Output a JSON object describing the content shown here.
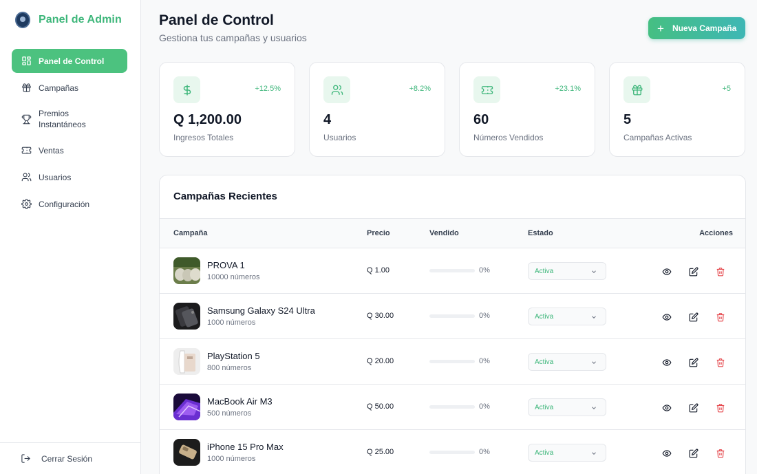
{
  "sidebar": {
    "brand": "Panel de Admin",
    "items": [
      {
        "label": "Panel de Control",
        "icon": "dashboard-icon",
        "active": true
      },
      {
        "label": "Campañas",
        "icon": "gift-icon"
      },
      {
        "label": "Premios Instantáneos",
        "icon": "trophy-icon"
      },
      {
        "label": "Ventas",
        "icon": "ticket-icon"
      },
      {
        "label": "Usuarios",
        "icon": "users-icon"
      },
      {
        "label": "Configuración",
        "icon": "gear-icon"
      }
    ],
    "logout": "Cerrar Sesión"
  },
  "header": {
    "title": "Panel de Control",
    "subtitle": "Gestiona tus campañas y usuarios",
    "new_button": "Nueva Campaña"
  },
  "stats": [
    {
      "value": "Q 1,200.00",
      "label": "Ingresos Totales",
      "change": "+12.5%",
      "icon": "dollar-icon"
    },
    {
      "value": "4",
      "label": "Usuarios",
      "change": "+8.2%",
      "icon": "users-icon"
    },
    {
      "value": "60",
      "label": "Números Vendidos",
      "change": "+23.1%",
      "icon": "ticket-icon"
    },
    {
      "value": "5",
      "label": "Campañas Activas",
      "change": "+5",
      "icon": "gift-icon"
    }
  ],
  "campaigns": {
    "title": "Campañas Recientes",
    "columns": {
      "campaign": "Campaña",
      "price": "Precio",
      "sold": "Vendido",
      "status": "Estado",
      "actions": "Acciones"
    },
    "rows": [
      {
        "name": "PROVA 1",
        "count": "10000 números",
        "price": "Q 1.00",
        "progress": 0,
        "pct": "0%",
        "status": "Activa"
      },
      {
        "name": "Samsung Galaxy S24 Ultra",
        "count": "1000 números",
        "price": "Q 30.00",
        "progress": 0,
        "pct": "0%",
        "status": "Activa"
      },
      {
        "name": "PlayStation 5",
        "count": "800 números",
        "price": "Q 20.00",
        "progress": 0,
        "pct": "0%",
        "status": "Activa"
      },
      {
        "name": "MacBook Air M3",
        "count": "500 números",
        "price": "Q 50.00",
        "progress": 0,
        "pct": "0%",
        "status": "Activa"
      },
      {
        "name": "iPhone 15 Pro Max",
        "count": "1000 números",
        "price": "Q 25.00",
        "progress": 0,
        "pct": "0%",
        "status": "Activa"
      }
    ]
  },
  "colors": {
    "accent": "#4cc27f",
    "accent_text": "#3db67a",
    "danger": "#e5484d"
  }
}
